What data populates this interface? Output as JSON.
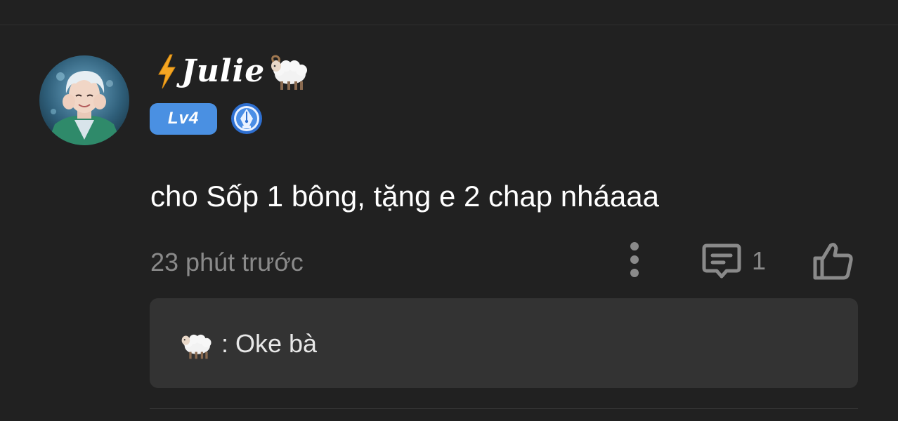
{
  "comment": {
    "author": {
      "name": "Julie",
      "name_icons": [
        "lightning-bolt-icon",
        "sheep-icon"
      ],
      "level_badge": "Lv4",
      "extra_badge": "pen-nib-badge-icon"
    },
    "text": "cho Sốp 1 bông, tặng e 2 chap nháaaa",
    "timestamp": "23 phút trước",
    "reply_count": "1",
    "icons": [
      "more-vertical-icon",
      "comment-icon",
      "thumbs-up-icon"
    ],
    "colors": {
      "background": "#212121",
      "level_badge": "#4a90e2",
      "muted_text": "#8a8a8a",
      "reply_box": "#333333"
    }
  },
  "reply": {
    "prefix_icon": "sheep-icon",
    "text": ": Oke bà"
  }
}
